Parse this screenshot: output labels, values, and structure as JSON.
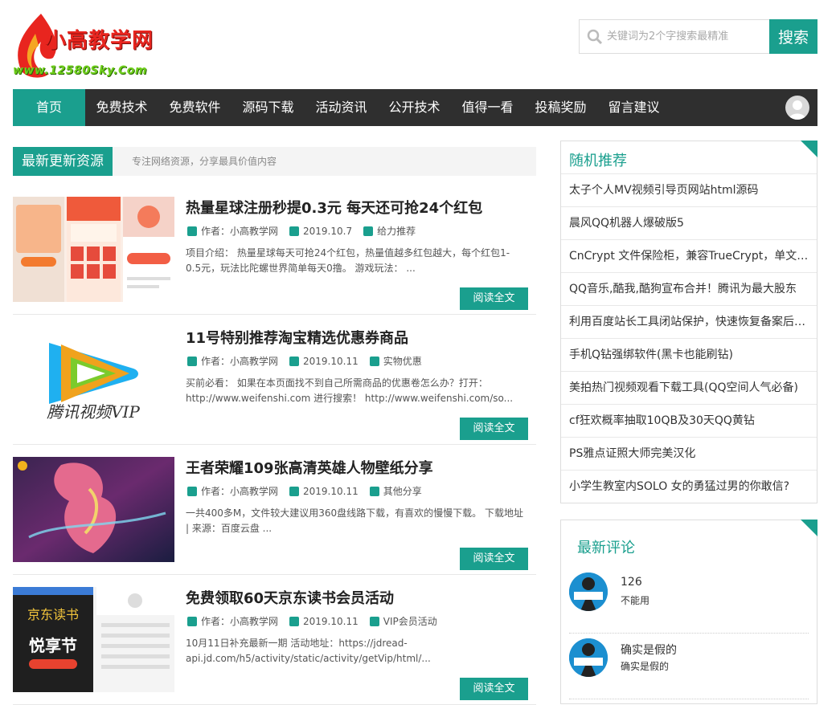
{
  "logo": {
    "main": "小高教学网",
    "url": "www.12580Sky.Com"
  },
  "search": {
    "placeholder": "关键词为2个字搜索最精准",
    "button": "搜索"
  },
  "nav": {
    "items": [
      "首页",
      "免费技术",
      "免费软件",
      "源码下载",
      "活动资讯",
      "公开技术",
      "值得一看",
      "投稿奖励",
      "留言建议"
    ]
  },
  "section": {
    "title": "最新更新资源",
    "subtitle": "专注网络资源，分享最具价值内容"
  },
  "posts": [
    {
      "title": "热量星球注册秒提0.3元 每天还可抢24个红包",
      "author": "作者：小高教学网",
      "date": "2019.10.7",
      "category": "给力推荐",
      "desc": "项目介绍： 热量星球每天可抢24个红包，热量值越多红包越大，每个红包1-0.5元，玩法比陀螺世界简单每天0撸。 游戏玩法： ...",
      "button": "阅读全文"
    },
    {
      "title": "11号特别推荐淘宝精选优惠券商品",
      "author": "作者：小高教学网",
      "date": "2019.10.11",
      "category": "实物优惠",
      "desc": "买前必看： 如果在本页面找不到自己所需商品的优惠卷怎么办？打开：http://www.weifenshi.com 进行搜索！ http://www.weifenshi.com/so...",
      "button": "阅读全文"
    },
    {
      "title": "王者荣耀109张高清英雄人物壁纸分享",
      "author": "作者：小高教学网",
      "date": "2019.10.11",
      "category": "其他分享",
      "desc": "一共400多M，文件较大建议用360盘线路下载，有喜欢的慢慢下载。 下载地址 | 来源：百度云盘 ...",
      "button": "阅读全文"
    },
    {
      "title": "免费领取60天京东读书会员活动",
      "author": "作者：小高教学网",
      "date": "2019.10.11",
      "category": "VIP会员活动",
      "desc": "10月11日补充最新一期 活动地址：https://jdread-api.jd.com/h5/activity/static/activity/getVip/html/...",
      "button": "阅读全文"
    }
  ],
  "thumbs": {
    "tencent_text": "腾讯视频VIP",
    "jd_text1": "京东读书",
    "jd_text2": "悦享节"
  },
  "random": {
    "title": "随机推荐",
    "items": [
      "太子个人MV视频引导页网站html源码",
      "晨风QQ机器人爆破版5",
      "CnCrypt 文件保险柜，兼容TrueCrypt，单文件加密工具",
      "QQ音乐,酷我,酷狗宣布合并！腾讯为最大股东",
      "利用百度站长工具闭站保护，快速恢复备案后网站排名",
      "手机Q钻强绑软件(黑卡也能刷钻)",
      "美拍热门视频观看下载工具(QQ空间人气必备)",
      "cf狂欢概率抽取10QB及30天QQ黄钻",
      "PS雅点证照大师完美汉化",
      "小学生教室内SOLO 女的勇猛过男的你敢信?"
    ]
  },
  "comments": {
    "title": "最新评论",
    "items": [
      {
        "name": "126",
        "text": "不能用"
      },
      {
        "name": "确实是假的",
        "text": "确实是假的"
      }
    ]
  },
  "colors": {
    "accent": "#1a9f8e",
    "nav_bg": "#2f2f2f"
  }
}
